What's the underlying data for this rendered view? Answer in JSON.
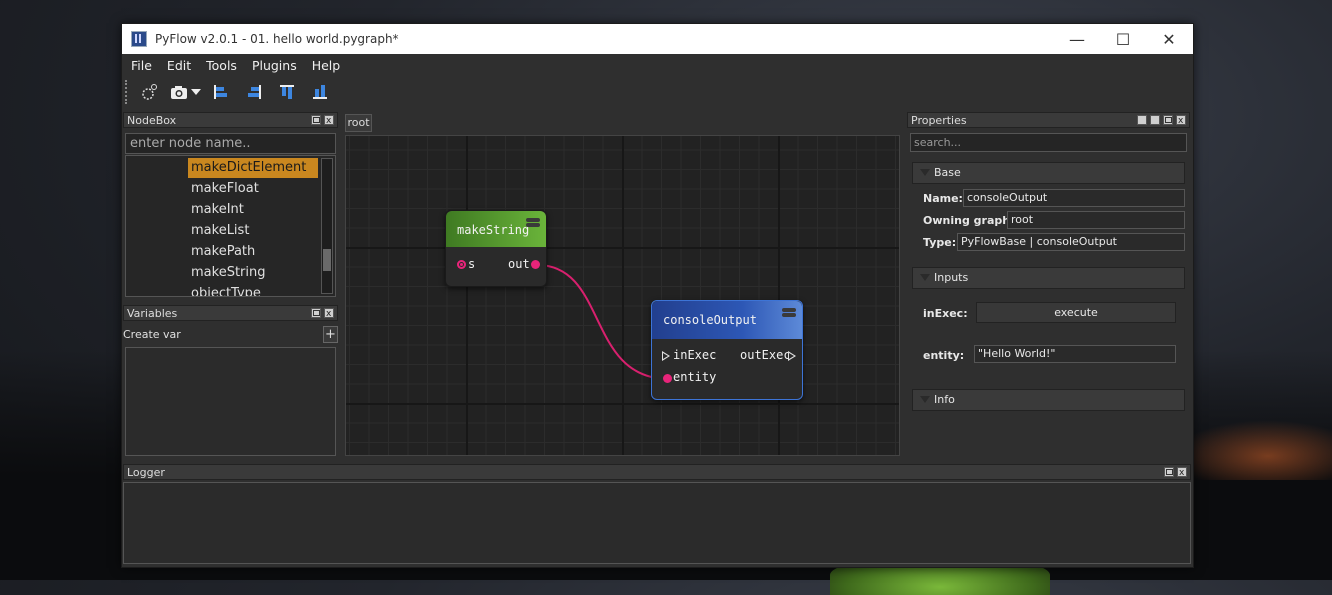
{
  "window": {
    "title": "PyFlow v2.0.1 - 01. hello world.pygraph*"
  },
  "window_controls": {
    "minimize": "—",
    "maximize": "☐",
    "close": "✕"
  },
  "menu": [
    "File",
    "Edit",
    "Tools",
    "Plugins",
    "Help"
  ],
  "toolbar": {
    "tools": [
      "settings-icon",
      "screenshot-icon",
      "dropdown-arrow-icon",
      "align-left-icon",
      "align-right-icon",
      "align-top-icon",
      "align-bottom-icon"
    ]
  },
  "nodebox": {
    "title": "NodeBox",
    "search_placeholder": "enter node name..",
    "items": [
      {
        "label": "makeDictElement",
        "selected": true
      },
      {
        "label": "makeFloat"
      },
      {
        "label": "makeInt"
      },
      {
        "label": "makeList"
      },
      {
        "label": "makePath"
      },
      {
        "label": "makeString"
      },
      {
        "label": "objectType"
      }
    ]
  },
  "variables": {
    "title": "Variables",
    "create_label": "Create var",
    "add_label": "+"
  },
  "graph": {
    "tab": "root",
    "nodes": [
      {
        "id": "makeString",
        "title": "makeString",
        "header_color": "#5aa030",
        "inputs": [
          "s"
        ],
        "outputs": [
          "out"
        ]
      },
      {
        "id": "consoleOutput",
        "title": "consoleOutput",
        "header_color": "#2a4ea8",
        "inputs": [
          "inExec",
          "entity"
        ],
        "outputs": [
          "outExec"
        ]
      }
    ],
    "connection_color": "#d8206e"
  },
  "properties": {
    "title": "Properties",
    "search_placeholder": "search...",
    "sections": {
      "base": "Base",
      "inputs": "Inputs",
      "info": "Info"
    },
    "fields": {
      "name_label": "Name:",
      "name_value": "consoleOutput",
      "owning_label": "Owning graph:",
      "owning_value": "root",
      "type_label": "Type:",
      "type_value": "PyFlowBase | consoleOutput",
      "inexec_label": "inExec:",
      "inexec_button": "execute",
      "entity_label": "entity:",
      "entity_value": "\"Hello World!\""
    }
  },
  "logger": {
    "title": "Logger"
  }
}
